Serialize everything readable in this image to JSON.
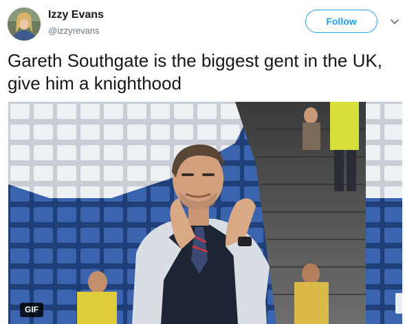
{
  "user": {
    "display_name": "Izzy Evans",
    "handle": "@izzyrevans"
  },
  "actions": {
    "follow_label": "Follow",
    "caret_icon": "chevron-down-icon"
  },
  "tweet": {
    "text": "Gareth Southgate is the biggest gent in the UK, give him a knighthood"
  },
  "media": {
    "badge": "GIF"
  },
  "colors": {
    "accent": "#1da1f2",
    "text": "#14171a",
    "secondary_text": "#657786"
  }
}
